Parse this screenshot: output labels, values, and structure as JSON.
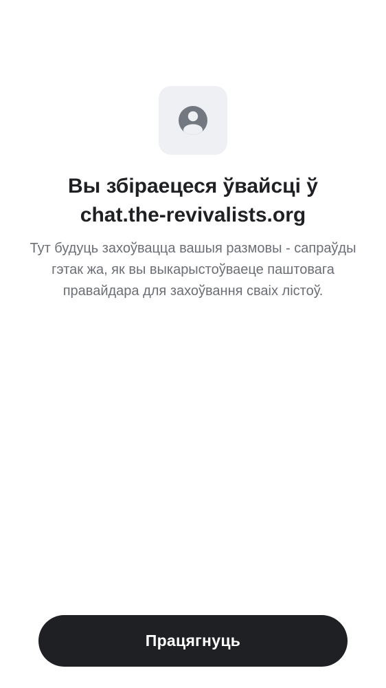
{
  "header": {
    "icon": "account-circle-icon",
    "title_line1": "Вы збіраецеся ўвайсці ў",
    "title_line2": "chat.the-revivalists.org"
  },
  "body": {
    "description": "Тут будуць захоўвацца вашыя размовы - сапраўды гэтак жа, як вы выкарыстоўваеце паштовага правайдара для захоўвання сваіх лістоў."
  },
  "footer": {
    "continue_label": "Працягнуць"
  },
  "colors": {
    "background": "#ffffff",
    "icon_tile": "#eff0f3",
    "icon": "#737780",
    "title": "#1f2024",
    "description": "#6c6e75",
    "button": "#1f2024",
    "button_text": "#ffffff"
  }
}
